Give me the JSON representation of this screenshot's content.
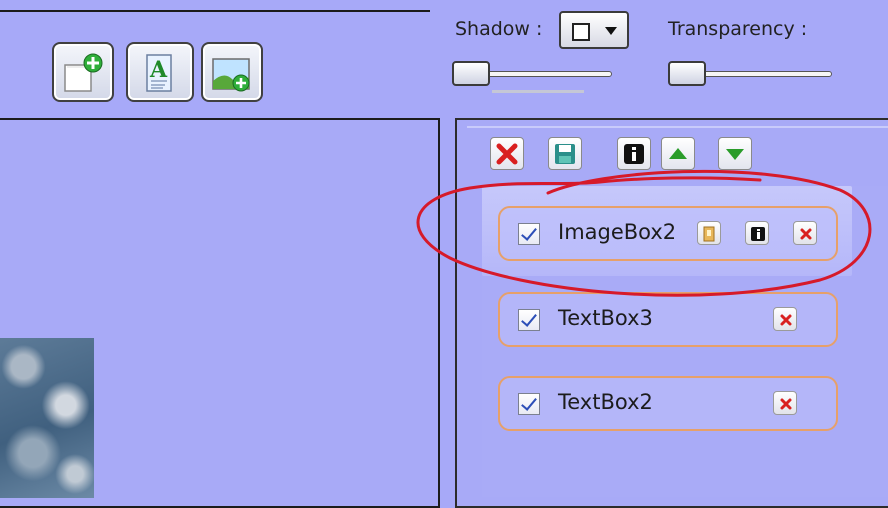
{
  "toolbar": {
    "buttons": [
      {
        "name": "add-page-button",
        "icon": "new-page-plus-icon"
      },
      {
        "name": "add-text-button",
        "icon": "text-box-icon"
      },
      {
        "name": "add-image-button",
        "icon": "add-image-icon"
      }
    ]
  },
  "shadow": {
    "label": "Shadow :",
    "value_icon": "empty-square-icon"
  },
  "transparency": {
    "label": "Transparency :"
  },
  "layer_tools": [
    {
      "name": "delete-layer-button",
      "icon": "red-x-icon"
    },
    {
      "name": "save-layer-button",
      "icon": "save-disk-icon"
    },
    {
      "name": "layer-info-button",
      "icon": "info-icon"
    },
    {
      "name": "move-layer-up-button",
      "icon": "green-up-arrow-icon"
    },
    {
      "name": "move-layer-down-button",
      "icon": "green-down-arrow-icon"
    }
  ],
  "layers": [
    {
      "label": "ImageBox2",
      "checked": true,
      "has_image_button": true,
      "has_info_button": true
    },
    {
      "label": "TextBox3",
      "checked": true
    },
    {
      "label": "TextBox2",
      "checked": true
    }
  ],
  "colors": {
    "background": "#a7a9f8",
    "item_border": "#e6a06a",
    "annotation": "#d61a2a",
    "delete_red": "#d92020",
    "arrow_green": "#2a9c2a"
  }
}
